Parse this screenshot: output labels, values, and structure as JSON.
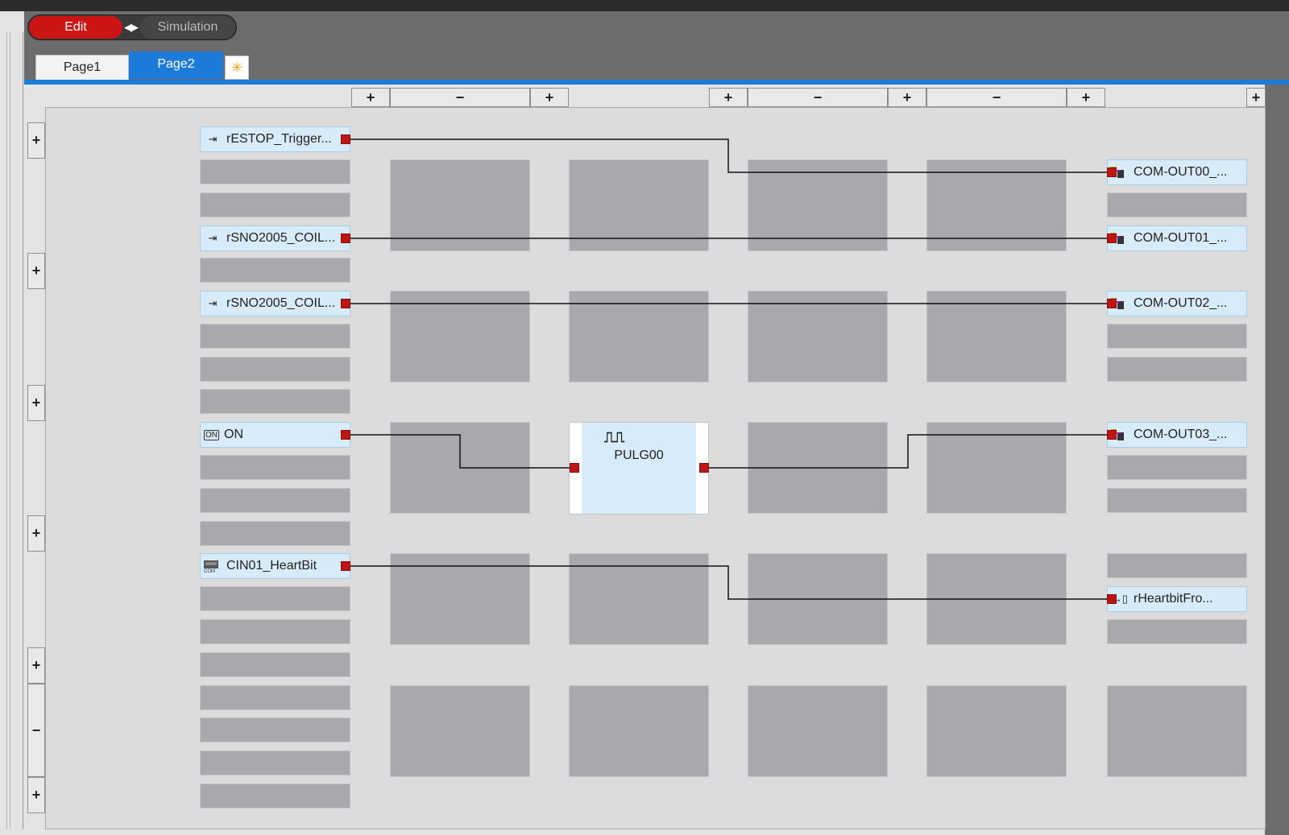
{
  "mode_toggle": {
    "edit_label": "Edit",
    "simulation_label": "Simulation",
    "swap_icon": "◀▶",
    "active": "Edit"
  },
  "tabs": [
    {
      "label": "Page1"
    },
    {
      "label": "Page2",
      "active": true
    }
  ],
  "new_tab_icon": "✳",
  "column_controls": [
    "+",
    "−",
    "+",
    "+",
    "−",
    "+",
    "−",
    "+",
    "+"
  ],
  "row_controls": [
    "+",
    "+",
    "+",
    "+",
    "+",
    "−",
    "+"
  ],
  "inputs": [
    {
      "label": "rESTOP_Trigger...",
      "icon": "⇥",
      "icon_name": "input-variable-icon"
    },
    {
      "label": "rSNO2005_COIL...",
      "icon": "⇥",
      "icon_name": "input-variable-icon"
    },
    {
      "label": "rSNO2005_COIL...",
      "icon": "⇥",
      "icon_name": "input-variable-icon"
    },
    {
      "label": "ON",
      "icon": "ON",
      "icon_name": "on-constant-icon"
    },
    {
      "label": "CIN01_HeartBit",
      "icon": "",
      "icon_name": "com-input-icon"
    }
  ],
  "function_block": {
    "name": "PULG00",
    "icon": "⎍⎍",
    "icon_name": "pulse-generator-icon"
  },
  "outputs": [
    {
      "label": "COM-OUT00_...",
      "icon_name": "com-output-icon"
    },
    {
      "label": "COM-OUT01_...",
      "icon_name": "com-output-icon"
    },
    {
      "label": "COM-OUT02_...",
      "icon_name": "com-output-icon"
    },
    {
      "label": "COM-OUT03_...",
      "icon_name": "com-output-icon"
    },
    {
      "label": "rHeartbitFro...",
      "icon": "→▯",
      "icon_name": "output-variable-icon"
    }
  ],
  "colors": {
    "edit_active": "#cc1414",
    "tab_active": "#1c7bd8",
    "node_fill": "#d7ecf8",
    "empty_slot": "#a9a8ad",
    "port": "#c01515"
  }
}
